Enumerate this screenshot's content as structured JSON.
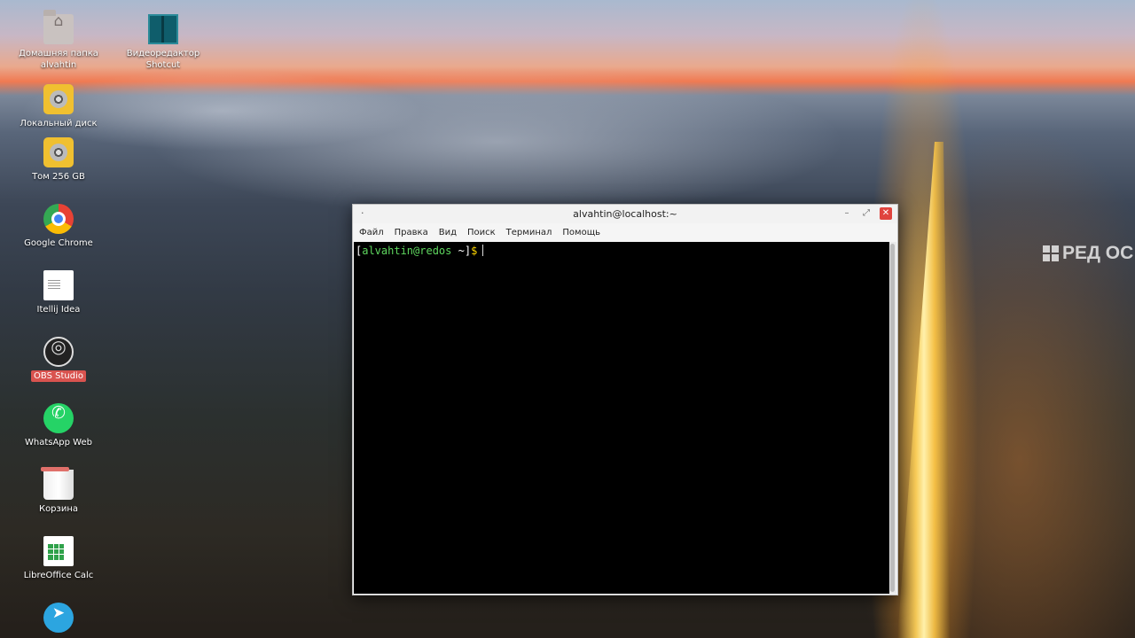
{
  "desktop": {
    "icons": [
      {
        "id": "home",
        "line1": "Домашняя папка",
        "line2": "alvahtin",
        "icon": "home-folder-icon"
      },
      {
        "id": "shotcut",
        "line1": "Видеоредактор",
        "line2": "Shotcut",
        "icon": "shotcut-icon"
      },
      {
        "id": "local-disk",
        "line1": "Локальный диск",
        "icon": "disk-drive-icon"
      },
      {
        "id": "volume",
        "line1": "Том 256 GB",
        "icon": "disk-drive-icon"
      },
      {
        "id": "chrome",
        "line1": "Google Chrome",
        "icon": "chrome-icon"
      },
      {
        "id": "intellij",
        "line1": "Itellij Idea",
        "icon": "document-icon"
      },
      {
        "id": "obs",
        "line1": "OBS Studio",
        "icon": "obs-icon",
        "selected": true
      },
      {
        "id": "whatsapp",
        "line1": "WhatsApp Web",
        "icon": "whatsapp-icon"
      },
      {
        "id": "trash",
        "line1": "Корзина",
        "icon": "trash-icon"
      },
      {
        "id": "calc",
        "line1": "LibreOffice Calc",
        "icon": "spreadsheet-icon"
      },
      {
        "id": "telegram",
        "line1": "",
        "icon": "telegram-icon"
      }
    ],
    "watermark": "РЕД ОС"
  },
  "terminal": {
    "title": "alvahtin@localhost:~",
    "window_menu_icon": "·",
    "controls": {
      "minimize": "–",
      "maximize": "⤢",
      "close": "✕"
    },
    "menu": [
      "Файл",
      "Правка",
      "Вид",
      "Поиск",
      "Терминал",
      "Помощь"
    ],
    "prompt": {
      "open": "[",
      "user_host": "alvahtin@redos",
      "path": " ~",
      "close": "]",
      "symbol": "$"
    }
  },
  "colors": {
    "prompt_user": "#5fd75f",
    "prompt_symbol": "#ffd700",
    "close_button": "#e0443e",
    "selected_label": "#d9534f"
  }
}
